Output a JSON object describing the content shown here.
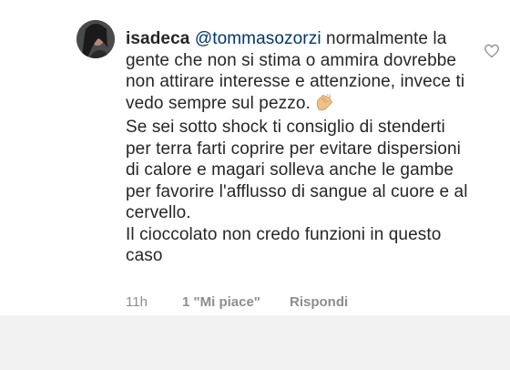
{
  "comment": {
    "username": "isadeca",
    "mention": "@tommasozorzi",
    "text_part1": " normalmente la gente che non si stima o ammira dovrebbe non attirare interesse e attenzione, invece ti vedo sempre sul pezzo.",
    "emoji": "clapping-hands-icon",
    "text_part2": "Se sei sotto shock ti consiglio di stenderti per terra farti coprire per evitare dispersioni di calore e magari solleva anche le gambe per favorire l'afflusso di sangue al cuore e al cervello.",
    "text_part3": "Il cioccolato non credo funzioni in questo caso"
  },
  "meta": {
    "time": "11h",
    "likes": "1 \"Mi piace\"",
    "reply": "Rispondi"
  },
  "colors": {
    "text": "#262626",
    "meta": "#8e8e8e",
    "mention": "#00376b",
    "bottom": "#f2f2f2"
  }
}
